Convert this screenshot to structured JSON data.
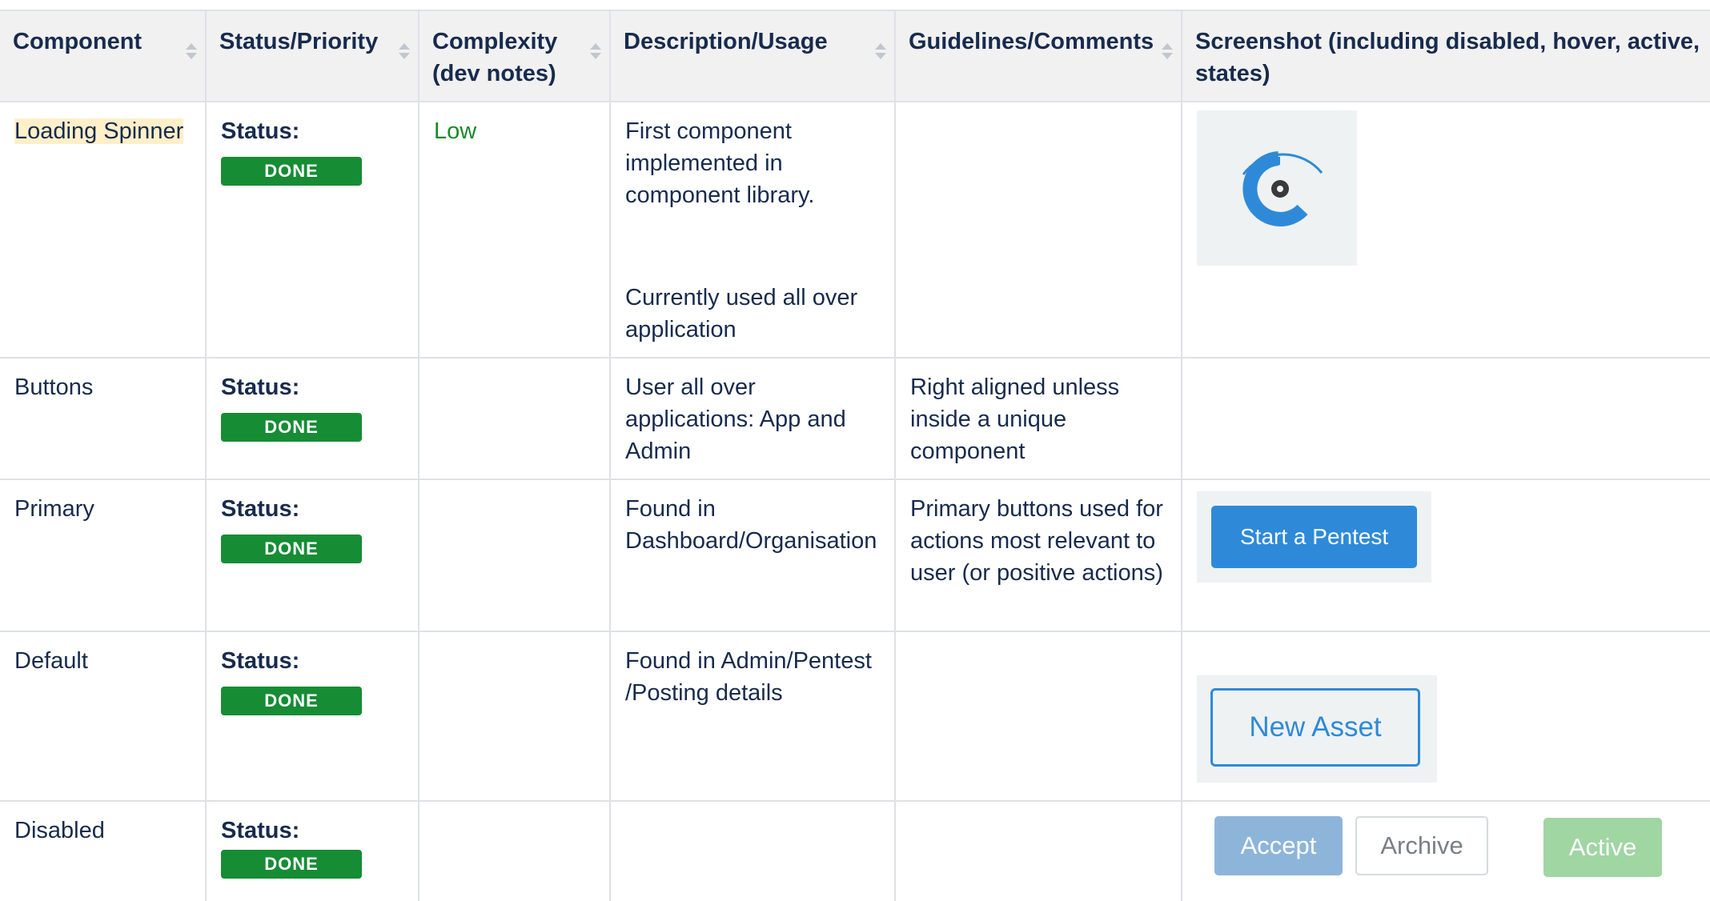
{
  "table": {
    "headers": [
      {
        "label": "Component",
        "sortable": true
      },
      {
        "label": "Status/Priority",
        "sortable": true
      },
      {
        "label": "Complexity (dev notes)",
        "sortable": true
      },
      {
        "label": "Description/Usage",
        "sortable": true
      },
      {
        "label": "Guidelines/Comments",
        "sortable": true
      },
      {
        "label": "Screenshot (including disabled, hover, active, states)",
        "sortable": false
      }
    ],
    "rows": [
      {
        "component": "Loading Spinner",
        "status_label": "Status:",
        "status_value": "DONE",
        "complexity": "Low",
        "description_1": "First component implemented in component library.",
        "description_2": "Currently used all over application",
        "guidelines": ""
      },
      {
        "component": "Buttons",
        "status_label": "Status:",
        "status_value": "DONE",
        "complexity": "",
        "description_1": "User all over applications: App and Admin",
        "guidelines": "Right aligned unless inside a unique component"
      },
      {
        "component": "Primary",
        "status_label": "Status:",
        "status_value": "DONE",
        "complexity": "",
        "description_1": "Found in Dashboard/Organisation",
        "guidelines": "Primary buttons used for actions most relevant to user (or positive actions)",
        "screenshot_button": "Start a Pentest"
      },
      {
        "component": "Default",
        "status_label": "Status:",
        "status_value": "DONE",
        "complexity": "",
        "description_1": "Found in Admin/Pentest /Posting details",
        "guidelines": "",
        "screenshot_button": "New Asset"
      },
      {
        "component": "Disabled",
        "status_label": "Status:",
        "status_value": "DONE",
        "complexity": "",
        "description_1": "",
        "guidelines": "",
        "screenshot_buttons": [
          "Accept",
          "Archive",
          "Active"
        ]
      }
    ]
  },
  "colors": {
    "status_done": "#168c34",
    "complexity_low": "#188a29",
    "primary_blue": "#2e8ad8",
    "highlight": "#fff0c9",
    "header_bg": "#f1f1f1"
  },
  "icons": [
    "sort-icon",
    "loading-spinner-icon"
  ]
}
